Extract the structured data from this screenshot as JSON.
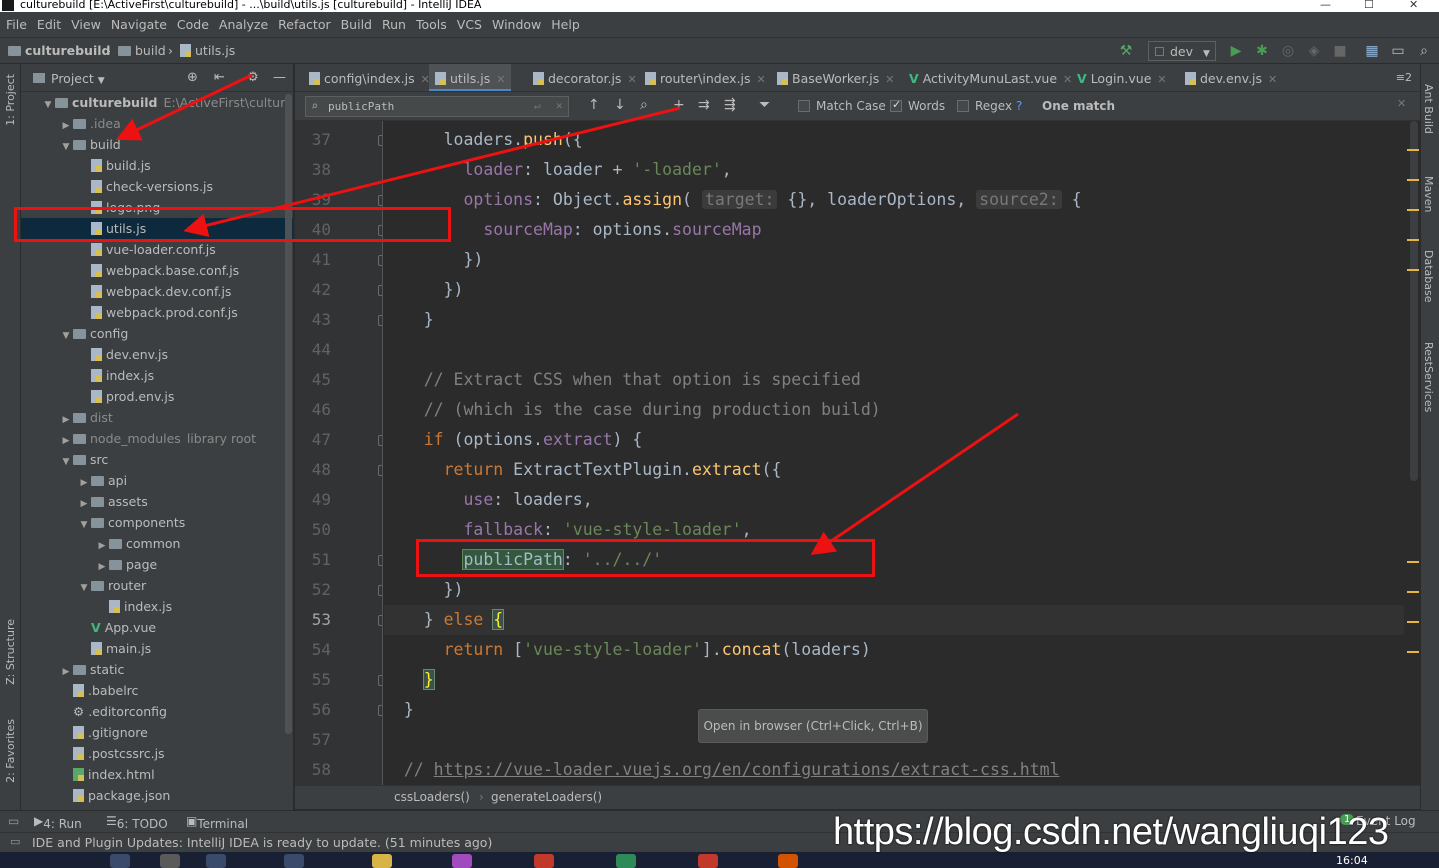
{
  "window": {
    "title": "culturebuild [E:\\ActiveFirst\\culturebuild] - ...\\build\\utils.js [culturebuild] - IntelliJ IDEA",
    "controls": [
      "—",
      "☐",
      "✕"
    ]
  },
  "menu": [
    "File",
    "Edit",
    "View",
    "Navigate",
    "Code",
    "Analyze",
    "Refactor",
    "Build",
    "Run",
    "Tools",
    "VCS",
    "Window",
    "Help"
  ],
  "navbar": {
    "crumbs": [
      "culturebuild",
      "build",
      "utils.js"
    ],
    "run_config": "dev"
  },
  "left_strip": {
    "project_label": "1: Project",
    "structure_label": "Z: Structure",
    "favorites_label": "2: Favorites"
  },
  "project_panel": {
    "title": "Project",
    "tree": [
      {
        "label": "culturebuild",
        "suffix": "E:\\ActiveFirst\\culturebuild",
        "depth": 0,
        "type": "folder",
        "expanded": true,
        "bold": true
      },
      {
        "label": ".idea",
        "depth": 1,
        "type": "folder",
        "expanded": false,
        "dim": true
      },
      {
        "label": "build",
        "depth": 1,
        "type": "folder",
        "expanded": true
      },
      {
        "label": "build.js",
        "depth": 2,
        "type": "file"
      },
      {
        "label": "check-versions.js",
        "depth": 2,
        "type": "file"
      },
      {
        "label": "logo.png",
        "depth": 2,
        "type": "file"
      },
      {
        "label": "utils.js",
        "depth": 2,
        "type": "file",
        "selected": true
      },
      {
        "label": "vue-loader.conf.js",
        "depth": 2,
        "type": "file"
      },
      {
        "label": "webpack.base.conf.js",
        "depth": 2,
        "type": "file"
      },
      {
        "label": "webpack.dev.conf.js",
        "depth": 2,
        "type": "file"
      },
      {
        "label": "webpack.prod.conf.js",
        "depth": 2,
        "type": "file"
      },
      {
        "label": "config",
        "depth": 1,
        "type": "folder",
        "expanded": true
      },
      {
        "label": "dev.env.js",
        "depth": 2,
        "type": "file"
      },
      {
        "label": "index.js",
        "depth": 2,
        "type": "file"
      },
      {
        "label": "prod.env.js",
        "depth": 2,
        "type": "file"
      },
      {
        "label": "dist",
        "depth": 1,
        "type": "folder",
        "expanded": false,
        "dim": true
      },
      {
        "label": "node_modules",
        "suffix": "library root",
        "depth": 1,
        "type": "folder",
        "expanded": false,
        "dim": true
      },
      {
        "label": "src",
        "depth": 1,
        "type": "folder",
        "expanded": true
      },
      {
        "label": "api",
        "depth": 2,
        "type": "folder",
        "expanded": false
      },
      {
        "label": "assets",
        "depth": 2,
        "type": "folder",
        "expanded": false
      },
      {
        "label": "components",
        "depth": 2,
        "type": "folder",
        "expanded": true
      },
      {
        "label": "common",
        "depth": 3,
        "type": "folder",
        "expanded": false
      },
      {
        "label": "page",
        "depth": 3,
        "type": "folder",
        "expanded": false
      },
      {
        "label": "router",
        "depth": 2,
        "type": "folder",
        "expanded": true
      },
      {
        "label": "index.js",
        "depth": 3,
        "type": "file"
      },
      {
        "label": "App.vue",
        "depth": 2,
        "type": "vue"
      },
      {
        "label": "main.js",
        "depth": 2,
        "type": "file"
      },
      {
        "label": "static",
        "depth": 1,
        "type": "folder",
        "expanded": false
      },
      {
        "label": ".babelrc",
        "depth": 1,
        "type": "file"
      },
      {
        "label": ".editorconfig",
        "depth": 1,
        "type": "gear"
      },
      {
        "label": ".gitignore",
        "depth": 1,
        "type": "file"
      },
      {
        "label": ".postcssrc.js",
        "depth": 1,
        "type": "file"
      },
      {
        "label": "index.html",
        "depth": 1,
        "type": "html"
      },
      {
        "label": "package.json",
        "depth": 1,
        "type": "file"
      }
    ]
  },
  "tabs": [
    {
      "label": "config\\index.js",
      "icon": "js"
    },
    {
      "label": "utils.js",
      "icon": "js",
      "active": true
    },
    {
      "label": "decorator.js",
      "icon": "js"
    },
    {
      "label": "router\\index.js",
      "icon": "js"
    },
    {
      "label": "BaseWorker.js",
      "icon": "js"
    },
    {
      "label": "ActivityMunuLast.vue",
      "icon": "vue"
    },
    {
      "label": "Login.vue",
      "icon": "vue"
    },
    {
      "label": "dev.env.js",
      "icon": "js"
    }
  ],
  "tabs_overflow": "≡2",
  "search": {
    "query": "publicPath",
    "match_case_label": "Match Case",
    "words_label": "Words",
    "regex_label": "Regex",
    "help": "?",
    "result": "One match",
    "match_case": false,
    "words": true,
    "regex": false
  },
  "editor": {
    "current_line": 53,
    "lines": [
      {
        "n": 37,
        "tokens": [
          [
            "",
            "      loaders."
          ],
          [
            "fn",
            "push"
          ],
          [
            "",
            "({"
          ]
        ]
      },
      {
        "n": 38,
        "tokens": [
          [
            "",
            "        "
          ],
          [
            "prop",
            "loader"
          ],
          [
            "",
            ": loader + "
          ],
          [
            "str",
            "'-loader'"
          ],
          [
            "",
            ","
          ]
        ]
      },
      {
        "n": 39,
        "tokens": [
          [
            "",
            "        "
          ],
          [
            "prop",
            "options"
          ],
          [
            "",
            ": Object."
          ],
          [
            "fn",
            "assign"
          ],
          [
            "",
            "( "
          ],
          [
            "hint",
            "target:"
          ],
          [
            "",
            " {}, loaderOptions, "
          ],
          [
            "hint",
            "source2:"
          ],
          [
            "",
            " {"
          ]
        ]
      },
      {
        "n": 40,
        "tokens": [
          [
            "",
            "          "
          ],
          [
            "prop",
            "sourceMap"
          ],
          [
            "",
            ": options."
          ],
          [
            "prop",
            "sourceMap"
          ]
        ]
      },
      {
        "n": 41,
        "tokens": [
          [
            "",
            "        })"
          ]
        ]
      },
      {
        "n": 42,
        "tokens": [
          [
            "",
            "      })"
          ]
        ]
      },
      {
        "n": 43,
        "tokens": [
          [
            "",
            "    }"
          ]
        ]
      },
      {
        "n": 44,
        "tokens": []
      },
      {
        "n": 45,
        "tokens": [
          [
            "cm",
            "    // Extract CSS when that option is specified"
          ]
        ]
      },
      {
        "n": 46,
        "tokens": [
          [
            "cm",
            "    // (which is the case during production build)"
          ]
        ]
      },
      {
        "n": 47,
        "tokens": [
          [
            "",
            "    "
          ],
          [
            "kw",
            "if"
          ],
          [
            "",
            " (options."
          ],
          [
            "prop",
            "extract"
          ],
          [
            "",
            ") {"
          ]
        ]
      },
      {
        "n": 48,
        "tokens": [
          [
            "",
            "      "
          ],
          [
            "kw",
            "return"
          ],
          [
            "",
            " ExtractTextPlugin."
          ],
          [
            "fn",
            "extract"
          ],
          [
            "",
            "({"
          ]
        ]
      },
      {
        "n": 49,
        "tokens": [
          [
            "",
            "        "
          ],
          [
            "prop",
            "use"
          ],
          [
            "",
            ": loaders,"
          ]
        ]
      },
      {
        "n": 50,
        "tokens": [
          [
            "",
            "        "
          ],
          [
            "prop",
            "fallback"
          ],
          [
            "",
            ": "
          ],
          [
            "str",
            "'vue-style-loader'"
          ],
          [
            "",
            ","
          ]
        ]
      },
      {
        "n": 51,
        "tokens": [
          [
            "",
            "        "
          ],
          [
            "hl",
            "publicPath"
          ],
          [
            "",
            ": "
          ],
          [
            "str",
            "'../../'"
          ]
        ]
      },
      {
        "n": 52,
        "tokens": [
          [
            "",
            "      })"
          ]
        ]
      },
      {
        "n": 53,
        "tokens": [
          [
            "",
            "    } "
          ],
          [
            "kw",
            "else"
          ],
          [
            "",
            " "
          ],
          [
            "brace",
            "{"
          ]
        ]
      },
      {
        "n": 54,
        "tokens": [
          [
            "",
            "      "
          ],
          [
            "kw",
            "return"
          ],
          [
            "",
            " ["
          ],
          [
            "str",
            "'vue-style-loader'"
          ],
          [
            "",
            "]."
          ],
          [
            "fn",
            "concat"
          ],
          [
            "",
            "(loaders)"
          ]
        ]
      },
      {
        "n": 55,
        "tokens": [
          [
            "",
            "    "
          ],
          [
            "brace",
            "}"
          ]
        ]
      },
      {
        "n": 56,
        "tokens": [
          [
            "",
            "  }"
          ]
        ]
      },
      {
        "n": 57,
        "tokens": []
      },
      {
        "n": 58,
        "tokens": [
          [
            "cm",
            "  // "
          ],
          [
            "lnk",
            "https://vue-loader.vuejs.org/en/configurations/extract-css.html"
          ]
        ]
      }
    ]
  },
  "tooltip": "Open in browser (Ctrl+Click, Ctrl+B)",
  "breadcrumb": [
    "cssLoaders()",
    "generateLoaders()"
  ],
  "right_strip": [
    "Ant Build",
    "Maven",
    "Database",
    "RestServices"
  ],
  "bottom_tools": {
    "run": "4: Run",
    "todo": "6: TODO",
    "terminal": "Terminal",
    "event_log": "Event Log",
    "event_count": "1"
  },
  "status": "IDE and Plugin Updates: IntelliJ IDEA is ready to update. (51 minutes ago)",
  "clock": "16:04",
  "watermark": "https://blog.csdn.net/wangliuqi123",
  "colors": {
    "annotation": "#ee1111",
    "accent": "#4a88c7",
    "bg": "#2b2b2b"
  }
}
